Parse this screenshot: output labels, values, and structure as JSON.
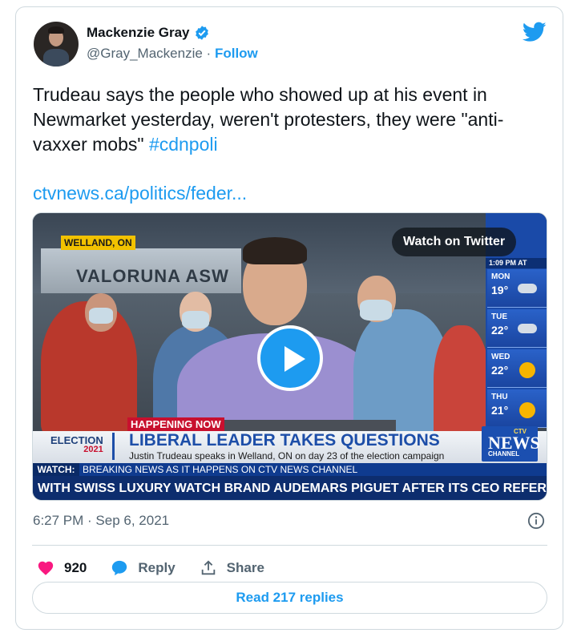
{
  "author": {
    "name": "Mackenzie Gray",
    "handle": "@Gray_Mackenzie",
    "separator": "·",
    "follow_label": "Follow"
  },
  "tweet": {
    "text": "Trudeau says the people who showed up at his event in Newmarket yesterday, weren't protesters, they were \"anti-vaxxer mobs\" ",
    "hashtag": "#cdnpoli",
    "link": "ctvnews.ca/politics/feder..."
  },
  "media": {
    "watch_label": "Watch on Twitter",
    "location_tag": "WELLAND, ON",
    "sign_text": "VALORUNA ASW",
    "weather": {
      "time": "1:09 PM AT",
      "days": [
        {
          "day": "MON",
          "temp": "19°",
          "icon": "cloud-icon"
        },
        {
          "day": "TUE",
          "temp": "22°",
          "icon": "cloud-icon"
        },
        {
          "day": "WED",
          "temp": "22°",
          "icon": "sun-icon"
        },
        {
          "day": "THU",
          "temp": "21°",
          "icon": "sun-cloud-icon"
        }
      ]
    },
    "happening": "HAPPENING NOW",
    "election_label": "ELECTION",
    "election_year": "2021",
    "headline": "LIBERAL LEADER TAKES QUESTIONS",
    "subhead": "Justin Trudeau speaks in Welland, ON on day 23 of the election campaign",
    "network_top": "CTV",
    "network_name": "NEWS",
    "network_sub": "CHANNEL",
    "watch_tag": "WATCH:",
    "watch_text": "BREAKING NEWS AS IT HAPPENS ON CTV NEWS CHANNEL",
    "ticker": "WITH SWISS LUXURY WATCH BRAND AUDEMARS PIGUET AFTER ITS CEO REFERRE"
  },
  "meta": {
    "timestamp": "6:27 PM · Sep 6, 2021"
  },
  "actions": {
    "like_count": "920",
    "reply_label": "Reply",
    "share_label": "Share",
    "read_replies": "Read 217 replies"
  },
  "colors": {
    "accent": "#1d9bf0",
    "like": "#f91880",
    "muted": "#536471"
  }
}
